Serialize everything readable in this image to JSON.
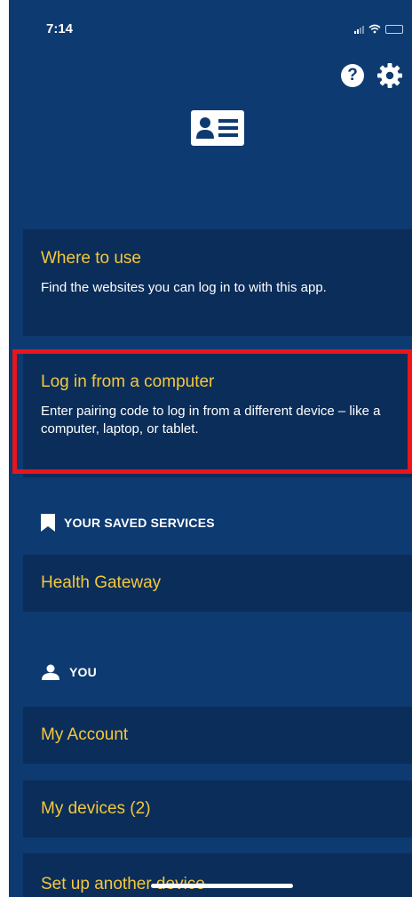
{
  "status_bar": {
    "time": "7:14"
  },
  "header": {
    "help_icon": "question-circle-icon",
    "help_label": "?",
    "settings_icon": "gear-icon",
    "logo_icon": "id-card-icon"
  },
  "menu": {
    "where_to_use": {
      "title": "Where to use",
      "description": "Find the websites you can log in to with this app."
    },
    "login_computer": {
      "title": "Log in from a computer",
      "description": "Enter pairing code to log in from a different device – like a computer, laptop, or tablet."
    }
  },
  "saved_services": {
    "header": "YOUR SAVED SERVICES",
    "icon": "bookmark-icon",
    "items": [
      {
        "label": "Health Gateway"
      }
    ]
  },
  "you": {
    "header": "YOU",
    "icon": "person-icon",
    "items": [
      {
        "label": "My Account"
      },
      {
        "label": "My devices (2)"
      },
      {
        "label": "Set up another device"
      }
    ]
  },
  "colors": {
    "background": "#0d3a70",
    "card": "#0a2d5a",
    "accent_text": "#f5c83a",
    "highlight": "#e8151d"
  }
}
